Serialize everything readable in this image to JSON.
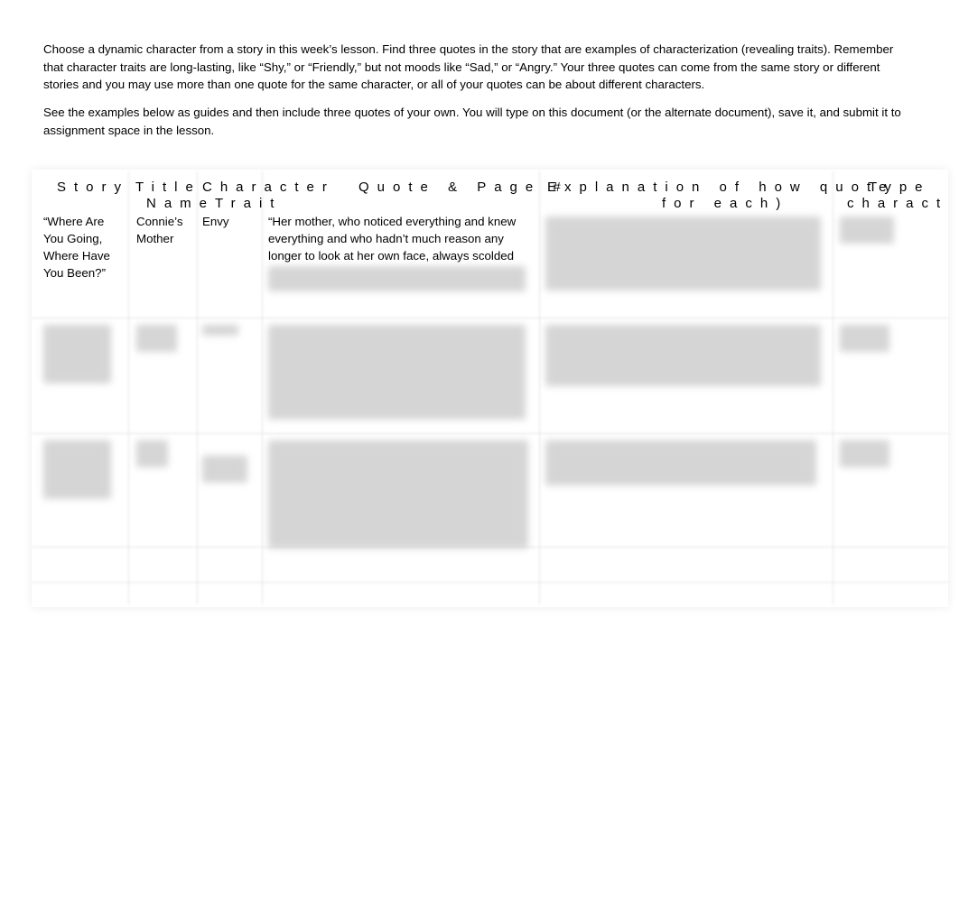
{
  "instructions": {
    "p1": "Choose a dynamic character from a story in this week’s lesson. Find three quotes in the story that are examples of characterization (revealing traits). Remember that character traits are long-lasting, like “Shy,” or “Friendly,” but not moods like “Sad,” or “Angry.” Your three quotes can come from the same story or different stories and you may use more than one quote for the same character, or all of your quotes can be about different characters.",
    "p2": "See the examples below as guides and then include three quotes of your own. You will type on this document (or the alternate document), save it, and submit it to assignment space in the lesson."
  },
  "table": {
    "headers": [
      "Story",
      "Title",
      "Character",
      "Name",
      "Trait",
      "Quote & Page #",
      "Explanation of how quote",
      "for each)",
      "Type",
      "charact"
    ],
    "row1": {
      "story": "“Where Are You Going, Where Have You Been?”",
      "character": "Connie’s Mother",
      "trait": "Envy",
      "quote": "“Her mother, who noticed everything and knew everything and who hadn’t much reason any longer to look at her own face, always scolded"
    }
  }
}
